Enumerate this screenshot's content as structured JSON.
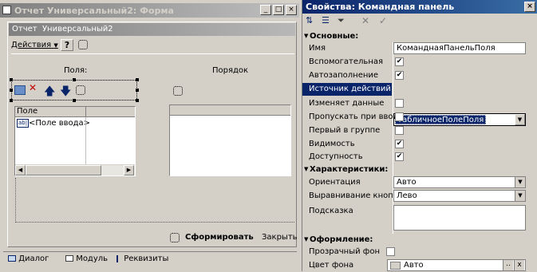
{
  "form_window": {
    "title": "Отчет Универсальный2: Форма",
    "controls": {
      "minimize": "_",
      "maximize": "□",
      "close": "×"
    }
  },
  "form": {
    "title": "Отчет  Универсальный2",
    "actions_label": "Действия",
    "help_label": "?",
    "fields_label": "Поля:",
    "order_label": "Порядок",
    "table_column": "Поле",
    "table_cell_tag": "ab|",
    "table_cell": "<Поле ввода>",
    "generate_button": "Сформировать",
    "close_button": "Закрыть"
  },
  "bottom_tabs": [
    {
      "label": "Диалог",
      "icon": "dialog-icon"
    },
    {
      "label": "Модуль",
      "icon": "module-icon"
    },
    {
      "label": "Реквизиты",
      "icon": "attributes-icon"
    }
  ],
  "properties": {
    "title": "Свойства: Командная панель",
    "sections": {
      "main": "Основные:",
      "characteristics": "Характеристики:",
      "design": "Оформление:"
    },
    "rows": {
      "name": {
        "label": "Имя",
        "value": "КоманднаяПанельПоля"
      },
      "auxiliary": {
        "label": "Вспомогательная",
        "checked": true
      },
      "autofill": {
        "label": "Автозаполнение",
        "checked": true
      },
      "action_source": {
        "label": "Источник действий",
        "value": "ТабличноеПолеПоля"
      },
      "changes_data": {
        "label": "Изменяет данные",
        "checked": false
      },
      "skip_on_input": {
        "label": "Пропускать при вводе",
        "checked": false
      },
      "first_in_group": {
        "label": "Первый в группе",
        "checked": false
      },
      "visibility": {
        "label": "Видимость",
        "checked": true
      },
      "availability": {
        "label": "Доступность",
        "checked": true
      },
      "orientation": {
        "label": "Ориентация",
        "value": "Авто"
      },
      "button_alignment": {
        "label": "Выравнивание кнопок",
        "value": "Лево"
      },
      "hint": {
        "label": "Подсказка",
        "value": ""
      },
      "transparent_bg": {
        "label": "Прозрачный фон",
        "checked": false
      },
      "bg_color": {
        "label": "Цвет фона",
        "value": "Авто"
      }
    }
  },
  "colors": {
    "title_active": "#0a246a",
    "selection": "#0a246a",
    "face": "#d4d0c8"
  }
}
